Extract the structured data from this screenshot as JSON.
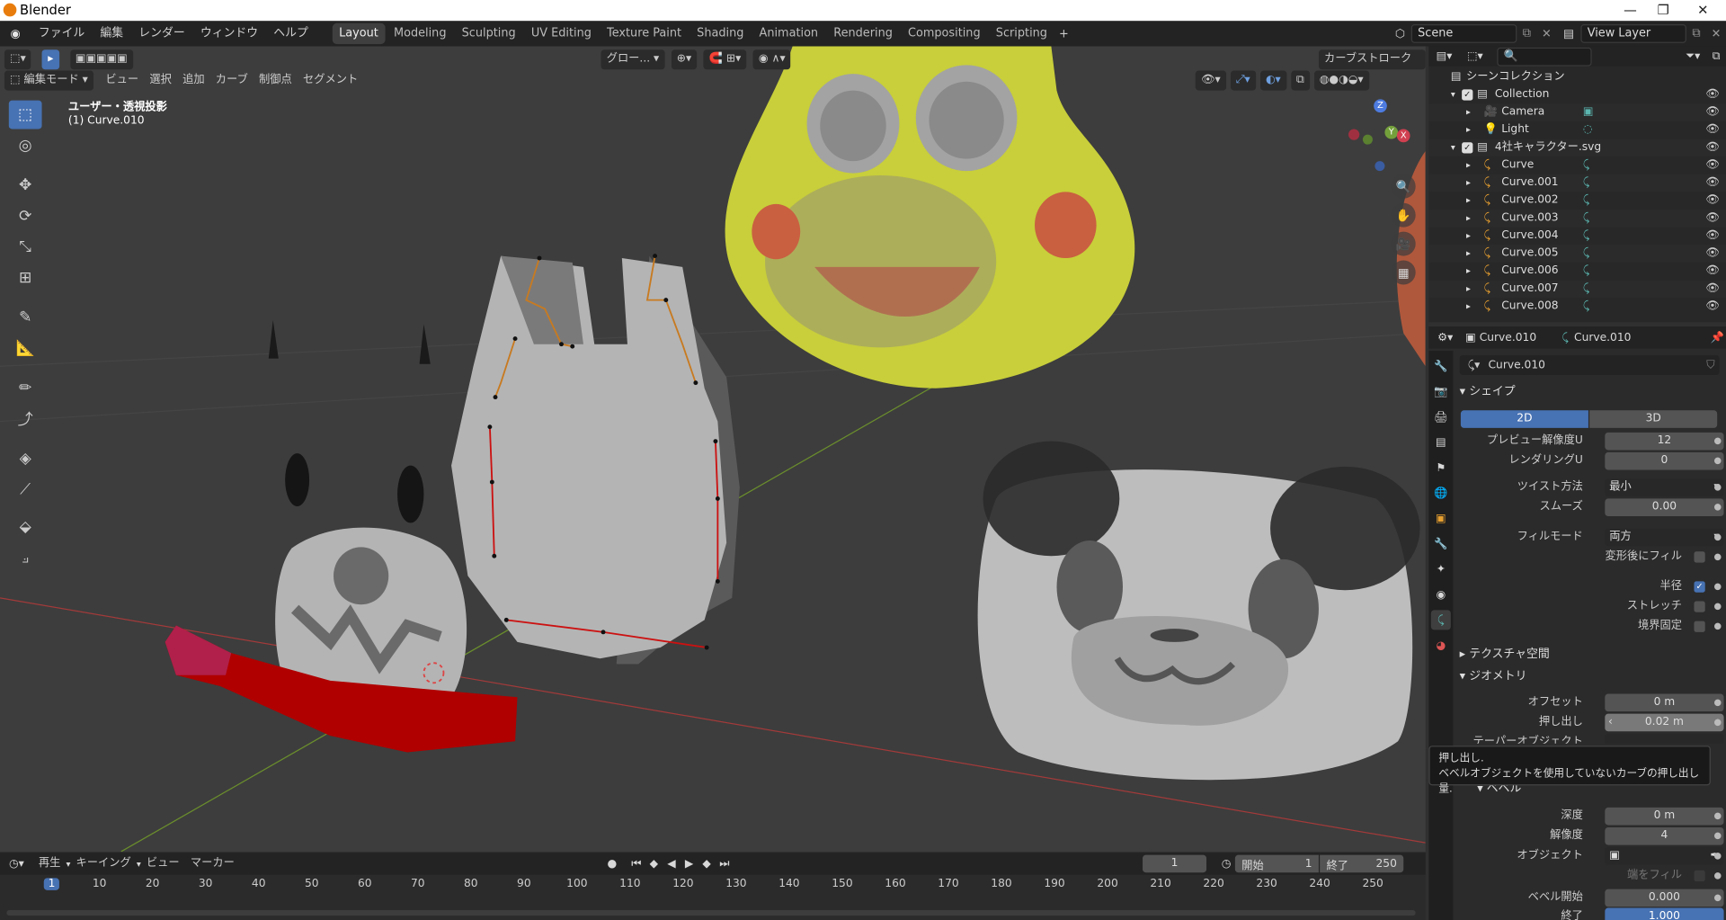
{
  "window": {
    "title": "Blender"
  },
  "menus": [
    "ファイル",
    "編集",
    "レンダー",
    "ウィンドウ",
    "ヘルプ"
  ],
  "workspaces": [
    "Layout",
    "Modeling",
    "Sculpting",
    "UV Editing",
    "Texture Paint",
    "Shading",
    "Animation",
    "Rendering",
    "Compositing",
    "Scripting"
  ],
  "active_workspace": "Layout",
  "scene": {
    "scene_name": "Scene",
    "view_layer": "View Layer"
  },
  "viewport": {
    "mode": "編集モード",
    "menus": [
      "ビュー",
      "選択",
      "追加",
      "カーブ",
      "制御点",
      "セグメント"
    ],
    "transform_orientation": "グロー...",
    "stroke_mode": "カーブストローク",
    "view_label": "ユーザー・透視投影",
    "object_label": "(1) Curve.010"
  },
  "outliner": {
    "root": "シーンコレクション",
    "rows": [
      {
        "label": "Collection",
        "indent": 1,
        "type": "collection"
      },
      {
        "label": "Camera",
        "indent": 2,
        "type": "camera"
      },
      {
        "label": "Light",
        "indent": 2,
        "type": "light"
      },
      {
        "label": "4社キャラクター.svg",
        "indent": 1,
        "type": "collection"
      },
      {
        "label": "Curve",
        "indent": 2,
        "type": "curve"
      },
      {
        "label": "Curve.001",
        "indent": 2,
        "type": "curve"
      },
      {
        "label": "Curve.002",
        "indent": 2,
        "type": "curve"
      },
      {
        "label": "Curve.003",
        "indent": 2,
        "type": "curve"
      },
      {
        "label": "Curve.004",
        "indent": 2,
        "type": "curve"
      },
      {
        "label": "Curve.005",
        "indent": 2,
        "type": "curve"
      },
      {
        "label": "Curve.006",
        "indent": 2,
        "type": "curve"
      },
      {
        "label": "Curve.007",
        "indent": 2,
        "type": "curve"
      },
      {
        "label": "Curve.008",
        "indent": 2,
        "type": "curve"
      }
    ]
  },
  "properties": {
    "object_name": "Curve.010",
    "data_name": "Curve.010",
    "datablock": "Curve.010",
    "shape": {
      "title": "シェイプ",
      "dim_2d": "2D",
      "dim_3d": "3D",
      "preview_res_label": "プレビュー解像度U",
      "preview_res": "12",
      "render_res_label": "レンダリングU",
      "render_res": "0",
      "twist_label": "ツイスト方法",
      "twist": "最小",
      "smooth_label": "スムーズ",
      "smooth": "0.00",
      "fill_mode_label": "フィルモード",
      "fill_mode": "両方",
      "fill_deform_label": "変形後にフィル",
      "radius_label": "半径",
      "stretch_label": "ストレッチ",
      "bounds_label": "境界固定"
    },
    "texture_space": "テクスチャ空間",
    "geometry": {
      "title": "ジオメトリ",
      "offset_label": "オフセット",
      "offset": "0 m",
      "extrude_label": "押し出し",
      "extrude": "0.02 m",
      "taper_label": "テーパーオブジェクト"
    },
    "bevel": {
      "title": "ベベル",
      "depth_label": "深度",
      "depth": "0 m",
      "resolution_label": "解像度",
      "resolution": "4",
      "object_label": "オブジェクト",
      "fill_caps_label": "端をフィル",
      "start_label": "ベベル開始",
      "start": "0.000",
      "end_label": "終了",
      "end": "1.000"
    }
  },
  "tooltip": {
    "title": "押し出し.",
    "text": "ベベルオブジェクトを使用していないカーブの押し出し量."
  },
  "timeline": {
    "menus": [
      "再生",
      "キーイング",
      "ビュー",
      "マーカー"
    ],
    "current_frame": "1",
    "start_label": "開始",
    "start": "1",
    "end_label": "終了",
    "end": "250",
    "ticks": [
      "1",
      "10",
      "20",
      "30",
      "40",
      "50",
      "60",
      "70",
      "80",
      "90",
      "100",
      "110",
      "120",
      "130",
      "140",
      "150",
      "160",
      "170",
      "180",
      "190",
      "200",
      "210",
      "220",
      "230",
      "240",
      "250"
    ]
  },
  "colors": {
    "accent": "#4772b3",
    "frog": "#c8cf3a",
    "scarf": "#b00000"
  }
}
